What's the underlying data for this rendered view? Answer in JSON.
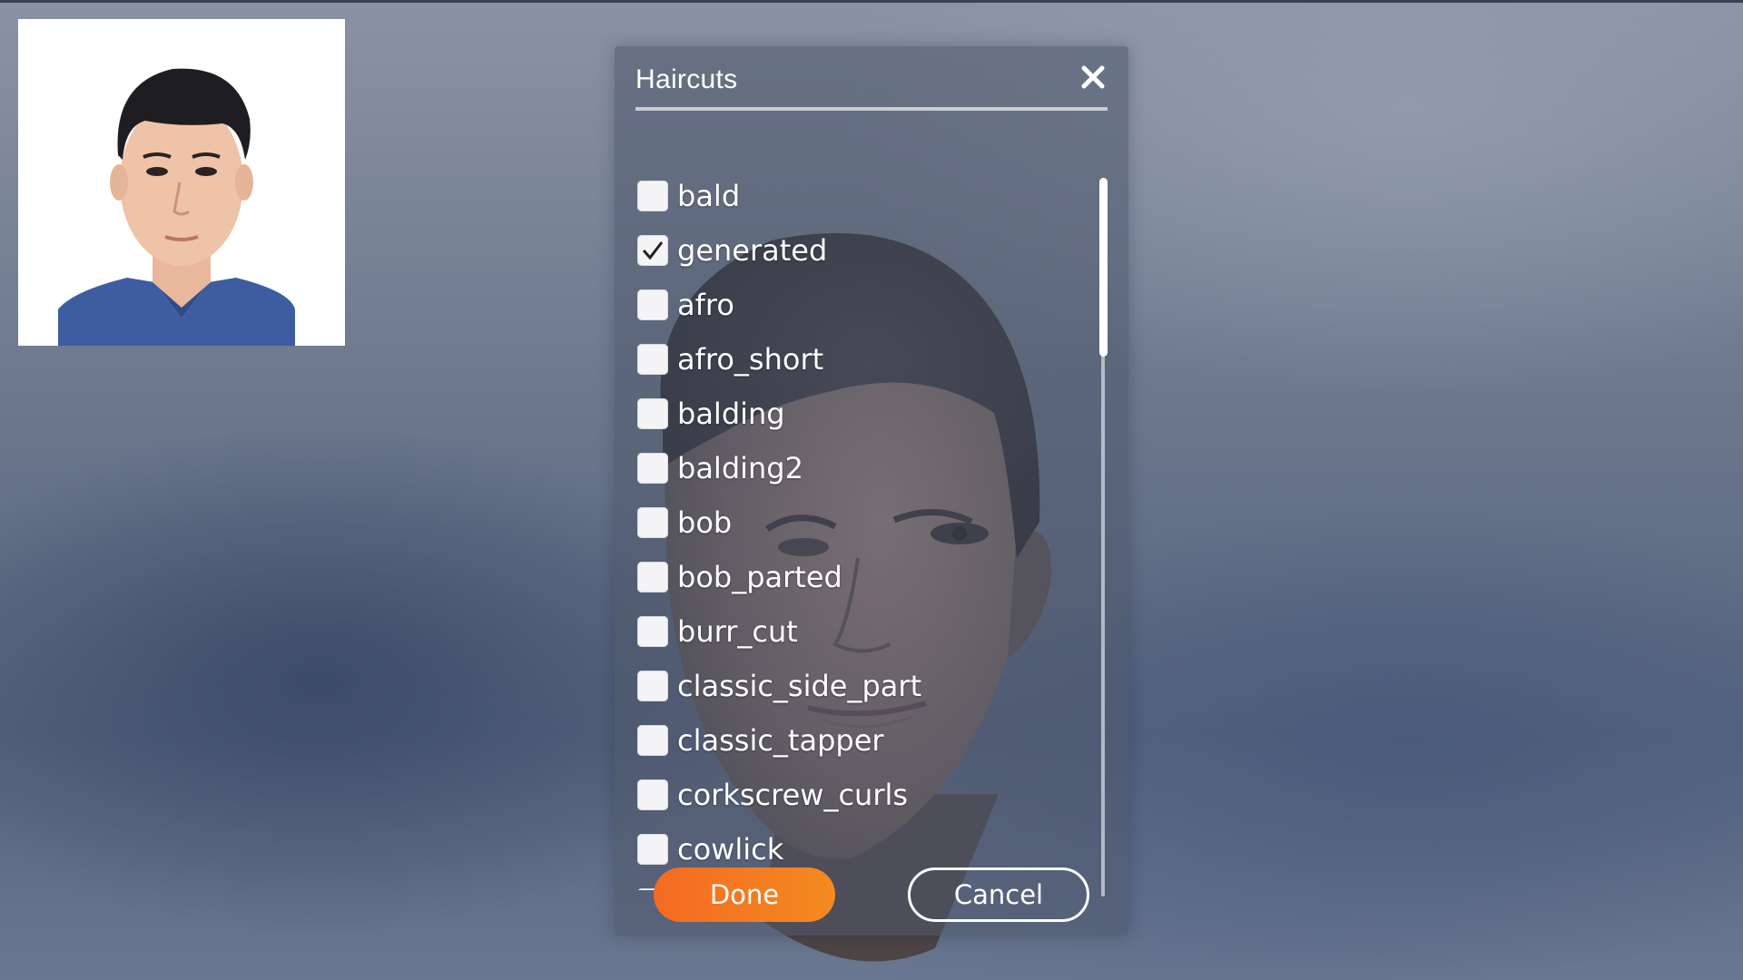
{
  "dialog": {
    "title": "Haircuts",
    "close_icon": "close-icon",
    "items": [
      {
        "label": "bald",
        "checked": false
      },
      {
        "label": "generated",
        "checked": true
      },
      {
        "label": "afro",
        "checked": false
      },
      {
        "label": "afro_short",
        "checked": false
      },
      {
        "label": "balding",
        "checked": false
      },
      {
        "label": "balding2",
        "checked": false
      },
      {
        "label": "bob",
        "checked": false
      },
      {
        "label": "bob_parted",
        "checked": false
      },
      {
        "label": "burr_cut",
        "checked": false
      },
      {
        "label": "classic_side_part",
        "checked": false
      },
      {
        "label": "classic_tapper",
        "checked": false
      },
      {
        "label": "corkscrew_curls",
        "checked": false
      },
      {
        "label": "cowlick",
        "checked": false
      }
    ],
    "done_label": "Done",
    "cancel_label": "Cancel"
  },
  "colors": {
    "accent": "#f47a22",
    "text": "#ffffff"
  }
}
